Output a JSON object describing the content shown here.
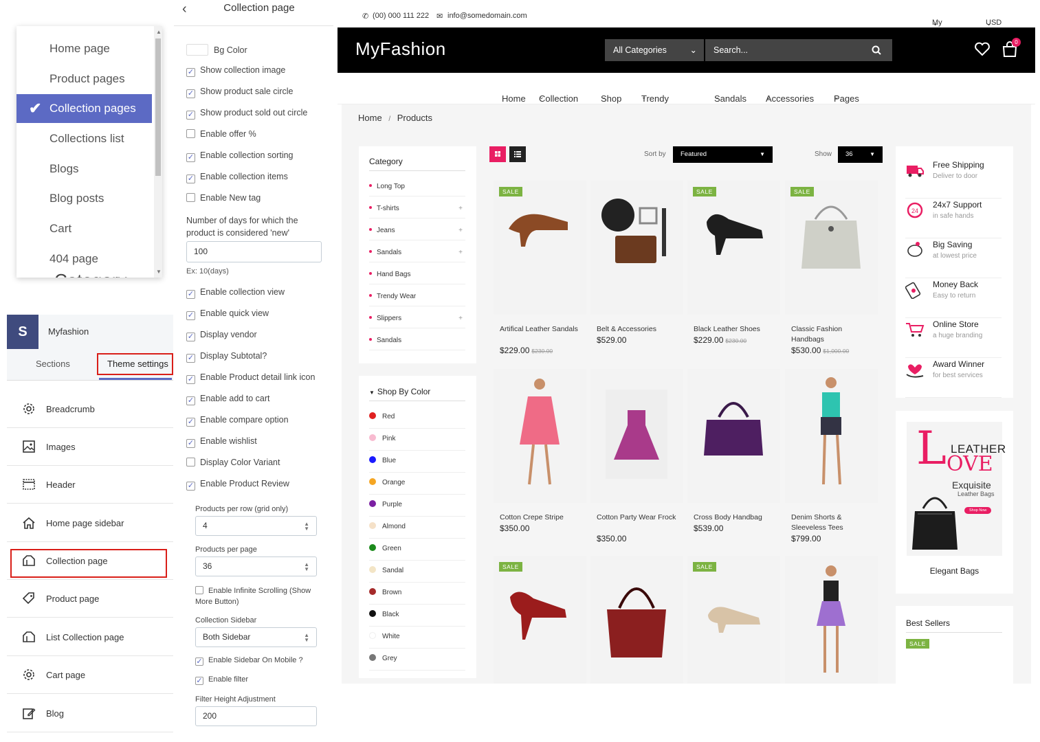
{
  "page_dropdown": {
    "items": [
      "Home page",
      "Product pages",
      "Collection pages",
      "Collections list",
      "Blogs",
      "Blog posts",
      "Cart",
      "404 page"
    ],
    "selected": "Collection pages",
    "behind_text": "Category"
  },
  "theme_panel": {
    "store_name": "Myfashion",
    "tabs": [
      "Sections",
      "Theme settings"
    ],
    "items": [
      "Breadcrumb",
      "Images",
      "Header",
      "Home page sidebar",
      "Collection page",
      "Product page",
      "List Collection page",
      "Cart page",
      "Blog"
    ],
    "highlight_color": "#d91e18"
  },
  "settings": {
    "title": "Collection page",
    "bg_color_label": "Bg Color",
    "checkboxes_a": [
      {
        "label": "Show collection image",
        "checked": true
      },
      {
        "label": "Show product sale circle",
        "checked": true
      },
      {
        "label": "Show product sold out circle",
        "checked": true
      },
      {
        "label": "Enable offer %",
        "checked": false
      },
      {
        "label": "Enable collection sorting",
        "checked": true
      },
      {
        "label": "Enable collection items",
        "checked": true
      },
      {
        "label": "Enable New tag",
        "checked": false
      }
    ],
    "new_days_label": "Number of days for which the product is considered 'new'",
    "new_days_value": "100",
    "new_days_hint": "Ex: 10(days)",
    "checkboxes_b": [
      {
        "label": "Enable collection view",
        "checked": true
      },
      {
        "label": "Enable quick view",
        "checked": true
      },
      {
        "label": "Display vendor",
        "checked": true
      },
      {
        "label": "Display Subtotal?",
        "checked": true
      },
      {
        "label": "Enable Product detail link icon",
        "checked": true
      },
      {
        "label": "Enable add to cart",
        "checked": true
      },
      {
        "label": "Enable compare option",
        "checked": true
      },
      {
        "label": "Enable wishlist",
        "checked": true
      },
      {
        "label": "Display Color Variant",
        "checked": false
      },
      {
        "label": "Enable Product Review",
        "checked": true
      }
    ],
    "per_row_label": "Products per row (grid only)",
    "per_row_value": "4",
    "per_page_label": "Products per page",
    "per_page_value": "36",
    "infinite_label": "Enable Infinite Scrolling (Show More Button)",
    "sidebar_label": "Collection Sidebar",
    "sidebar_value": "Both Sidebar",
    "sidebar_mobile_label": "Enable Sidebar On Mobile ?",
    "filter_label": "Enable filter",
    "filter_height_label": "Filter Height Adjustment",
    "filter_height_value": "200",
    "accent": "#5c6ac4"
  },
  "store": {
    "phone": "(00) 000 111 222",
    "email": "info@somedomain.com",
    "account": "My Account",
    "currency": "USD",
    "brand": "MyFashion",
    "all_categories": "All Categories",
    "search_placeholder": "Search...",
    "cart_count": "0",
    "nav": [
      "Home",
      "Collection",
      "Shop",
      "Trendy Wear",
      "Sandals",
      "Accessories",
      "Pages"
    ],
    "breadcrumb": [
      "Home",
      "Products"
    ],
    "sort_label": "Sort by",
    "sort_value": "Featured",
    "show_label": "Show",
    "show_value": "36",
    "category_title": "Category",
    "categories": [
      {
        "name": "Long Top",
        "plus": false
      },
      {
        "name": "T-shirts",
        "plus": true
      },
      {
        "name": "Jeans",
        "plus": true
      },
      {
        "name": "Sandals",
        "plus": true
      },
      {
        "name": "Hand Bags",
        "plus": false
      },
      {
        "name": "Trendy Wear",
        "plus": false
      },
      {
        "name": "Slippers",
        "plus": true
      },
      {
        "name": "Sandals",
        "plus": false
      }
    ],
    "color_title": "Shop By Color",
    "colors": [
      {
        "name": "Red",
        "hex": "#e02020"
      },
      {
        "name": "Pink",
        "hex": "#f8bbd0"
      },
      {
        "name": "Blue",
        "hex": "#1a1aff"
      },
      {
        "name": "Orange",
        "hex": "#f5a623"
      },
      {
        "name": "Purple",
        "hex": "#7b1fa2"
      },
      {
        "name": "Almond",
        "hex": "#f5e1c8"
      },
      {
        "name": "Green",
        "hex": "#1b8a1b"
      },
      {
        "name": "Sandal",
        "hex": "#f3e5c6"
      },
      {
        "name": "Brown",
        "hex": "#a52a2a"
      },
      {
        "name": "Black",
        "hex": "#111111"
      },
      {
        "name": "White",
        "hex": "#ffffff"
      },
      {
        "name": "Grey",
        "hex": "#777777"
      }
    ],
    "sale_badge": "SALE",
    "products": [
      {
        "name": "Artifical Leather Sandals",
        "price": "$229.00",
        "old": "$230.00",
        "sale": true,
        "icon": "heel-icon"
      },
      {
        "name": "Belt & Accessories",
        "price": "$529.00",
        "old": "",
        "sale": false,
        "icon": "belt-icon"
      },
      {
        "name": "Black Leather Shoes",
        "price": "$229.00",
        "old": "$230.00",
        "sale": true,
        "icon": "shoe-icon"
      },
      {
        "name": "Classic Fashion Handbags",
        "price": "$530.00",
        "old": "$1,000.00",
        "sale": true,
        "icon": "handbag-icon"
      },
      {
        "name": "Cotton Crepe Stripe",
        "price": "$350.00",
        "old": "",
        "sale": false,
        "icon": "dress-icon"
      },
      {
        "name": "Cotton Party Wear Frock",
        "price": "$350.00",
        "old": "",
        "sale": false,
        "icon": "frock-icon"
      },
      {
        "name": "Cross Body Handbag",
        "price": "$539.00",
        "old": "",
        "sale": false,
        "icon": "purple-bag-icon"
      },
      {
        "name": "Denim Shorts & Sleeveless Tees",
        "price": "$799.00",
        "old": "",
        "sale": false,
        "icon": "shorts-icon"
      },
      {
        "name": "",
        "price": "",
        "old": "",
        "sale": true,
        "icon": "red-heel-icon"
      },
      {
        "name": "",
        "price": "",
        "old": "",
        "sale": false,
        "icon": "red-bag-icon"
      },
      {
        "name": "",
        "price": "",
        "old": "",
        "sale": true,
        "icon": "flat-shoe-icon"
      },
      {
        "name": "",
        "price": "",
        "old": "",
        "sale": false,
        "icon": "skirt-icon"
      }
    ],
    "features": [
      {
        "title": "Free Shipping",
        "sub": "Deliver to door",
        "icon": "truck-icon"
      },
      {
        "title": "24x7 Support",
        "sub": "in safe hands",
        "icon": "support-icon"
      },
      {
        "title": "Big Saving",
        "sub": "at lowest price",
        "icon": "piggy-icon"
      },
      {
        "title": "Money Back",
        "sub": "Easy to return",
        "icon": "money-back-icon"
      },
      {
        "title": "Online Store",
        "sub": "a huge branding",
        "icon": "cart-icon"
      },
      {
        "title": "Award Winner",
        "sub": "for best services",
        "icon": "award-icon"
      }
    ],
    "banner": {
      "leather": "LEATHER",
      "love": "OVE",
      "l": "L",
      "exquisite": "Exquisite",
      "leather_bags": "Leather Bags",
      "shop_now": "Shop Now",
      "caption": "Elegant Bags"
    },
    "best_sellers": "Best Sellers",
    "brand_color": "#e91e63",
    "sale_color": "#7cb342"
  }
}
